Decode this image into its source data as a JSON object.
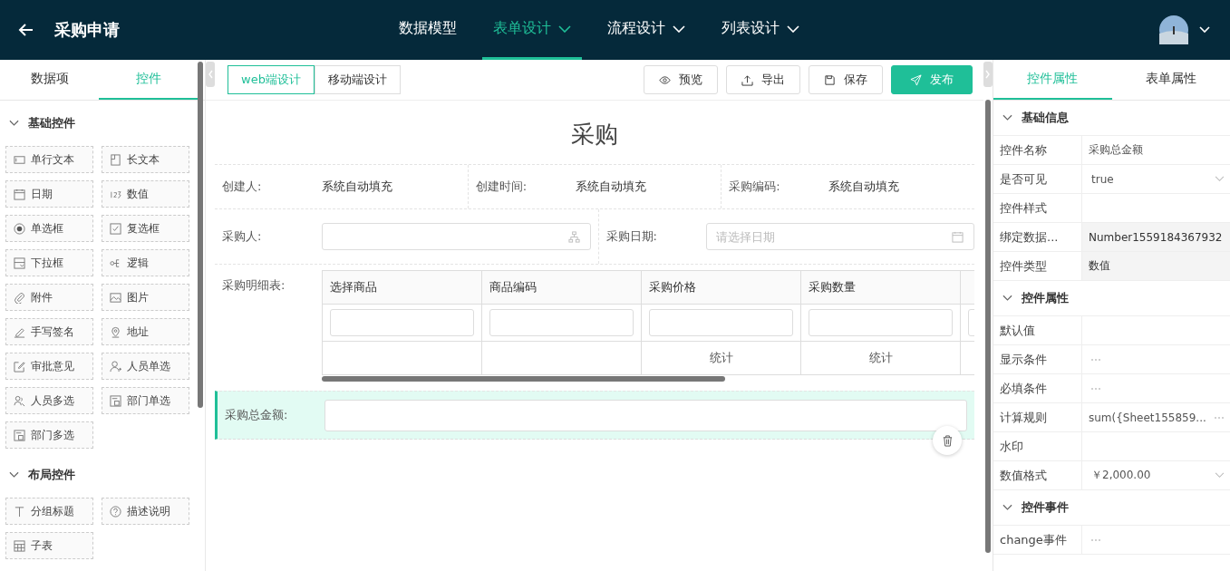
{
  "header": {
    "title": "采购申请",
    "nav": [
      {
        "label": "数据模型",
        "selected": false,
        "dropdown": false
      },
      {
        "label": "表单设计",
        "selected": true,
        "dropdown": true
      },
      {
        "label": "流程设计",
        "selected": false,
        "dropdown": true
      },
      {
        "label": "列表设计",
        "selected": false,
        "dropdown": true
      }
    ]
  },
  "left_panel": {
    "tabs": [
      {
        "label": "数据项",
        "selected": false
      },
      {
        "label": "控件",
        "selected": true
      }
    ],
    "sections": [
      {
        "title": "基础控件",
        "expanded": true,
        "items": [
          {
            "label": "单行文本"
          },
          {
            "label": "长文本"
          },
          {
            "label": "日期"
          },
          {
            "label": "数值"
          },
          {
            "label": "单选框"
          },
          {
            "label": "复选框"
          },
          {
            "label": "下拉框"
          },
          {
            "label": "逻辑"
          },
          {
            "label": "附件"
          },
          {
            "label": "图片"
          },
          {
            "label": "手写签名"
          },
          {
            "label": "地址"
          },
          {
            "label": "审批意见"
          },
          {
            "label": "人员单选"
          },
          {
            "label": "人员多选"
          },
          {
            "label": "部门单选"
          },
          {
            "label": "部门多选"
          }
        ]
      },
      {
        "title": "布局控件",
        "expanded": true,
        "items": [
          {
            "label": "分组标题"
          },
          {
            "label": "描述说明"
          },
          {
            "label": "子表"
          }
        ]
      }
    ]
  },
  "toolbar": {
    "modes": [
      {
        "label": "web端设计",
        "selected": true
      },
      {
        "label": "移动端设计",
        "selected": false
      }
    ],
    "buttons": [
      {
        "label": "预览",
        "kind": "default"
      },
      {
        "label": "导出",
        "kind": "default"
      },
      {
        "label": "保存",
        "kind": "default"
      },
      {
        "label": "发布",
        "kind": "primary"
      }
    ]
  },
  "form": {
    "title": "采购",
    "info_fields": [
      {
        "label": "创建人:",
        "value": "系统自动填充"
      },
      {
        "label": "创建时间:",
        "value": "系统自动填充"
      },
      {
        "label": "采购编码:",
        "value": "系统自动填充"
      }
    ],
    "input_fields": [
      {
        "label": "采购人:",
        "kind": "person"
      },
      {
        "label": "采购日期:",
        "kind": "date",
        "placeholder": "请选择日期"
      }
    ],
    "table": {
      "label": "采购明细表:",
      "columns": [
        {
          "header": "选择商品"
        },
        {
          "header": "商品编码"
        },
        {
          "header": "采购价格",
          "footer": "统计"
        },
        {
          "header": "采购数量",
          "footer": "统计"
        },
        {}
      ]
    },
    "total_field": {
      "label": "采购总金额:",
      "selected": true
    }
  },
  "right_panel": {
    "tabs": [
      {
        "label": "控件属性",
        "selected": true
      },
      {
        "label": "表单属性",
        "selected": false
      }
    ],
    "sections": [
      {
        "title": "基础信息",
        "expanded": true,
        "rows": [
          {
            "label": "控件名称",
            "value": "采购总金额",
            "kind": "text"
          },
          {
            "label": "是否可见",
            "value": "true",
            "kind": "select"
          },
          {
            "label": "控件样式",
            "kind": "text"
          },
          {
            "label": "绑定数据...",
            "value": "Number1559184367932",
            "kind": "readonly"
          },
          {
            "label": "控件类型",
            "value": "数值",
            "kind": "readonly"
          }
        ]
      },
      {
        "title": "控件属性",
        "expanded": true,
        "rows": [
          {
            "label": "默认值",
            "kind": "text"
          },
          {
            "label": "显示条件",
            "kind": "more"
          },
          {
            "label": "必填条件",
            "kind": "more"
          },
          {
            "label": "计算规则",
            "value": "sum({Sheet155859...",
            "kind": "more"
          },
          {
            "label": "水印",
            "kind": "text"
          },
          {
            "label": "数值格式",
            "value": "￥2,000.00",
            "kind": "select"
          }
        ]
      },
      {
        "title": "控件事件",
        "expanded": true,
        "rows": [
          {
            "label": "change事件",
            "kind": "more"
          }
        ]
      }
    ]
  }
}
